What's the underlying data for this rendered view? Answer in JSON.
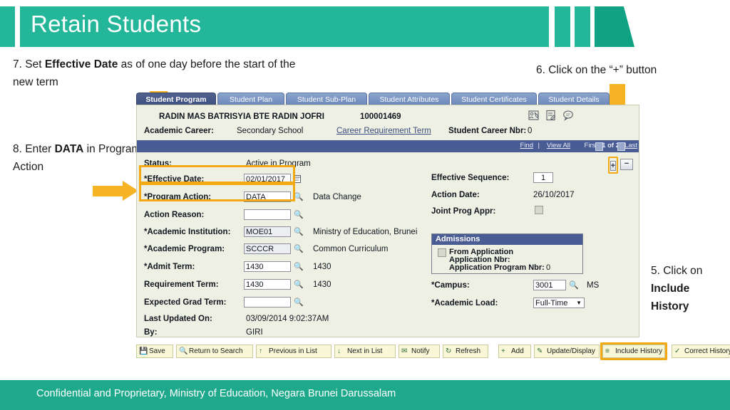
{
  "header": {
    "title": "Retain Students",
    "green": "#23b698",
    "green_dark": "#10a283"
  },
  "annotations": {
    "step7": {
      "prefix": "7. Set ",
      "strong": "Effective Date",
      "suffix": " as of one day before the start of the new term"
    },
    "step8": {
      "prefix": "8. Enter ",
      "strong": "DATA",
      "suffix": " in Program Action"
    },
    "step6": {
      "text": "6. Click on the “+” button"
    },
    "step5": {
      "prefix": "5. Click on ",
      "strong": "Include History"
    }
  },
  "tabs": [
    {
      "label": "Student Program",
      "active": true
    },
    {
      "label": "Student Plan",
      "active": false
    },
    {
      "label": "Student Sub-Plan",
      "active": false
    },
    {
      "label": "Student Attributes",
      "active": false
    },
    {
      "label": "Student Certificates",
      "active": false
    },
    {
      "label": "Student Details",
      "active": false
    }
  ],
  "student": {
    "name": "RADIN MAS BATRISYIA BTE RADIN JOFRI",
    "id": "100001469",
    "career_label": "Academic Career:",
    "career_value": "Secondary School",
    "career_req_term_link": "Career Requirement Term",
    "career_nbr_label": "Student Career Nbr:",
    "career_nbr_value": "0",
    "icons": [
      "student-note-icon",
      "notepad-icon",
      "comment-bubble-icon"
    ]
  },
  "nav": {
    "find": "Find",
    "separator": "|",
    "view_all": "View All",
    "first": "First",
    "count": "1 of 2",
    "last": "Last",
    "add_row": "+",
    "delete_row": "−"
  },
  "form": {
    "status": {
      "label": "Status:",
      "value": "Active in Program"
    },
    "effective_date": {
      "label": "*Effective Date:",
      "value": "02/01/2017"
    },
    "program_action": {
      "label": "*Program Action:",
      "value": "DATA",
      "desc": "Data Change"
    },
    "action_reason": {
      "label": "Action Reason:",
      "value": "",
      "desc": ""
    },
    "academic_institution": {
      "label": "*Academic Institution:",
      "value": "MOE01",
      "desc": "Ministry of Education, Brunei"
    },
    "academic_program": {
      "label": "*Academic Program:",
      "value": "SCCCR",
      "desc": "Common Curriculum"
    },
    "admit_term": {
      "label": "*Admit Term:",
      "value": "1430",
      "desc": "1430"
    },
    "requirement_term": {
      "label": "Requirement Term:",
      "value": "1430",
      "desc": "1430"
    },
    "expected_grad_term": {
      "label": "Expected Grad Term:",
      "value": "",
      "desc": ""
    },
    "last_updated_on": {
      "label": "Last Updated On:",
      "value": "03/09/2014  9:02:37AM"
    },
    "by": {
      "label": "By:",
      "value": "GIRI"
    },
    "effective_sequence": {
      "label": "Effective Sequence:",
      "value": "1"
    },
    "action_date": {
      "label": "Action Date:",
      "value": "26/10/2017"
    },
    "joint_prog_appr": {
      "label": "Joint Prog Appr:",
      "checked": false
    },
    "campus": {
      "label": "*Campus:",
      "value": "3001",
      "desc": "MS"
    },
    "academic_load": {
      "label": "*Academic Load:",
      "value": "Full-Time"
    }
  },
  "admissions": {
    "title": "Admissions",
    "from_application": "From Application",
    "application_nbr_label": "Application Nbr:",
    "application_nbr_value": "",
    "application_program_nbr_label": "Application Program Nbr:",
    "application_program_nbr_value": "0"
  },
  "toolbar": [
    {
      "label": "Save",
      "glyph": "💾"
    },
    {
      "label": "Return to Search",
      "glyph": "🔍"
    },
    {
      "label": "Previous in List",
      "glyph": "↑"
    },
    {
      "label": "Next in List",
      "glyph": "↓"
    },
    {
      "label": "Notify",
      "glyph": "✉"
    },
    {
      "label": "Refresh",
      "glyph": "↻"
    },
    {
      "label": "Add",
      "glyph": "+"
    },
    {
      "label": "Update/Display",
      "glyph": "✎"
    },
    {
      "label": "Include History",
      "glyph": "≡"
    },
    {
      "label": "Correct History",
      "glyph": "✓"
    }
  ],
  "footer": {
    "text": "Confidential and Proprietary, Ministry of Education, Negara Brunei Darussalam",
    "bg": "#1fa98c"
  },
  "accent": {
    "orange": "#f2a913",
    "blue_bar": "#4a5c94",
    "panel_bg": "#eef0e4"
  }
}
